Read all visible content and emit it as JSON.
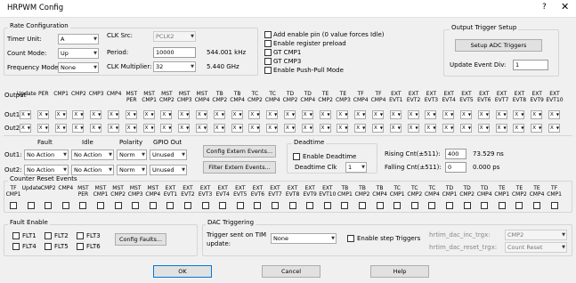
{
  "window": {
    "title": "HRPWM Config",
    "help_glyph": "?",
    "close_glyph": "✕"
  },
  "rate": {
    "group_label": "Rate Configuration",
    "timer_unit_label": "Timer Unit:",
    "timer_unit_value": "A",
    "count_mode_label": "Count Mode:",
    "count_mode_value": "Up",
    "freq_mode_label": "Frequency Mode:",
    "freq_mode_value": "None",
    "clk_src_label": "CLK Src:",
    "clk_src_value": "PCLK2",
    "period_label": "Period:",
    "period_value": "10000",
    "period_freq": "544.001 kHz",
    "clk_mult_label": "CLK Multiplier:",
    "clk_mult_value": "32",
    "clk_mult_freq": "5.440 GHz"
  },
  "options": {
    "add_enable_pin": "Add enable pin (0 value forces Idle)",
    "enable_register_preload": "Enable register preload",
    "gt_cmp1": "GT CMP1",
    "gt_cmp3": "GT CMP3",
    "enable_push_pull": "Enable Push-Pull Mode"
  },
  "trigger_setup": {
    "group_label": "Output Trigger Setup",
    "setup_adc_button": "Setup ADC Triggers",
    "update_event_div_label": "Update Event Div:",
    "update_event_div_value": "1"
  },
  "output": {
    "label": "Output",
    "columns": [
      [
        "",
        "Update"
      ],
      [
        "",
        "PER"
      ],
      [
        "",
        "CMP1"
      ],
      [
        "",
        "CMP2"
      ],
      [
        "",
        "CMP3"
      ],
      [
        "",
        "CMP4"
      ],
      [
        "MST",
        "PER"
      ],
      [
        "MST",
        "CMP1"
      ],
      [
        "MST",
        "CMP2"
      ],
      [
        "MST",
        "CMP3"
      ],
      [
        "MST",
        "CMP4"
      ],
      [
        "TB",
        "CMP2"
      ],
      [
        "TB",
        "CMP4"
      ],
      [
        "TC",
        "CMP2"
      ],
      [
        "TC",
        "CMP4"
      ],
      [
        "TD",
        "CMP2"
      ],
      [
        "TD",
        "CMP4"
      ],
      [
        "TE",
        "CMP2"
      ],
      [
        "TE",
        "CMP3"
      ],
      [
        "TF",
        "CMP4"
      ],
      [
        "TF",
        "CMP4"
      ],
      [
        "EXT",
        "EVT1"
      ],
      [
        "EXT",
        "EVT2"
      ],
      [
        "EXT",
        "EVT3"
      ],
      [
        "EXT",
        "EVT4"
      ],
      [
        "EXT",
        "EVT5"
      ],
      [
        "EXT",
        "EVT6"
      ],
      [
        "EXT",
        "EVT7"
      ],
      [
        "EXT",
        "EVT8"
      ],
      [
        "EXT",
        "EVT9"
      ],
      [
        "EXT",
        "EVT10"
      ]
    ],
    "rows": [
      "Out1:",
      "Out2:"
    ],
    "cell_value": "X"
  },
  "fault_idle": {
    "fault_label": "Fault",
    "idle_label": "Idle",
    "polarity_label": "Polarity",
    "gpio_label": "GPIO Out",
    "rows": [
      {
        "label": "Out1:",
        "fault": "No Action",
        "idle": "No Action",
        "polarity": "Norm",
        "gpio": "Unused"
      },
      {
        "label": "Out2:",
        "fault": "No Action",
        "idle": "No Action",
        "polarity": "Norm",
        "gpio": "Unused"
      }
    ],
    "config_extern_events": "Config Extern Events...",
    "filter_extern_events": "Filter Extern Events..."
  },
  "deadtime": {
    "label": "Deadtime",
    "enable_label": "Enable Deadtime",
    "clk_label": "Deadtime Clk",
    "clk_value": "1",
    "rising_label": "Rising Cnt(±511):",
    "rising_value": "400",
    "rising_time": "73.529 ns",
    "falling_label": "Falling Cnt(±511):",
    "falling_value": "0",
    "falling_time": "0.000 ps"
  },
  "counter_reset": {
    "group_label": "Counter Reset Events",
    "columns": [
      [
        "TF",
        "CMP1"
      ],
      [
        "",
        "Update"
      ],
      [
        "",
        "CMP2"
      ],
      [
        "",
        "CMP4"
      ],
      [
        "MST",
        "PER"
      ],
      [
        "MST",
        "CMP1"
      ],
      [
        "MST",
        "CMP2"
      ],
      [
        "MST",
        "CMP3"
      ],
      [
        "MST",
        "CMP4"
      ],
      [
        "EXT",
        "EVT1"
      ],
      [
        "EXT",
        "EVT2"
      ],
      [
        "EXT",
        "EVT3"
      ],
      [
        "EXT",
        "EVT4"
      ],
      [
        "EXT",
        "EVT5"
      ],
      [
        "EXT",
        "EVT6"
      ],
      [
        "EXT",
        "EVT7"
      ],
      [
        "EXT",
        "EVT8"
      ],
      [
        "EXT",
        "EVT9"
      ],
      [
        "EXT",
        "EVT10"
      ],
      [
        "TB",
        "CMP1"
      ],
      [
        "TB",
        "CMP2"
      ],
      [
        "TB",
        "CMP4"
      ],
      [
        "TC",
        "CMP1"
      ],
      [
        "TC",
        "CMP2"
      ],
      [
        "TC",
        "CMP4"
      ],
      [
        "TD",
        "CMP1"
      ],
      [
        "TD",
        "CMP2"
      ],
      [
        "TD",
        "CMP4"
      ],
      [
        "TE",
        "CMP1"
      ],
      [
        "TE",
        "CMP2"
      ],
      [
        "TE",
        "CMP4"
      ],
      [
        "TF",
        "CMP1"
      ]
    ]
  },
  "fault_enable": {
    "group_label": "Fault Enable",
    "flts": [
      "FLT1",
      "FLT2",
      "FLT3",
      "FLT4",
      "FLT5",
      "FLT6"
    ],
    "config_faults": "Config Faults..."
  },
  "dac": {
    "group_label": "DAC Triggering",
    "trigger_label_1": "Trigger sent on TIM",
    "trigger_label_2": "update:",
    "trigger_value": "None",
    "enable_step": "Enable step Triggers",
    "inc_label": "hrtim_dac_inc_trgx:",
    "inc_value": "CMP2",
    "reset_label": "hrtim_dac_reset_trgx:",
    "reset_value": "Count Reset"
  },
  "footer": {
    "ok": "OK",
    "cancel": "Cancel",
    "help": "Help"
  }
}
